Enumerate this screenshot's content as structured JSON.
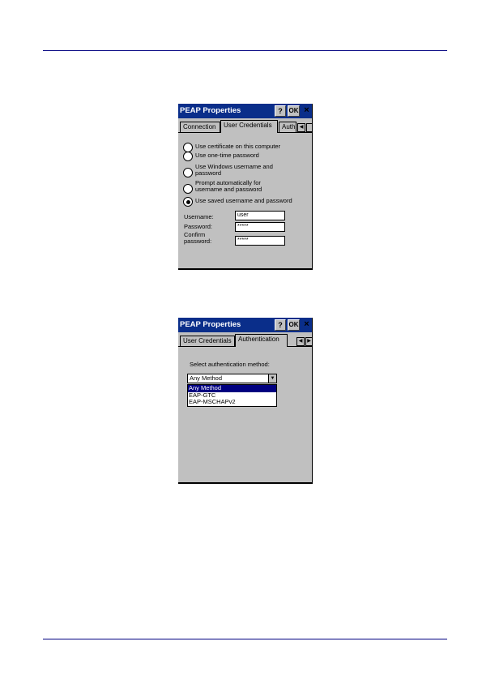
{
  "dialog1": {
    "title": "PEAP Properties",
    "help": "?",
    "ok": "OK",
    "close": "×",
    "tabs": [
      "Connection",
      "User Credentials",
      "Auth"
    ],
    "spin_left": "◀",
    "radios": [
      {
        "label": "Use certificate on this computer",
        "checked": false
      },
      {
        "label": "Use one-time password",
        "checked": false
      },
      {
        "label1": "Use Windows username and",
        "label2": "password",
        "checked": false
      },
      {
        "label1": "Prompt automatically for",
        "label2": "username and password",
        "checked": false
      },
      {
        "label": "Use saved username and password",
        "checked": true
      }
    ],
    "fields": {
      "username_label": "Username:",
      "username_value": "user",
      "password_label": "Password:",
      "password_value": "*****",
      "confirm_label1": "Confirm",
      "confirm_label2": "password:",
      "confirm_value": "*****"
    }
  },
  "dialog2": {
    "title": "PEAP Properties",
    "help": "?",
    "ok": "OK",
    "close": "×",
    "tabs": [
      "User Credentials",
      "Authentication"
    ],
    "spin_left": "◀",
    "spin_right": "▶",
    "select_label": "Select authentication method:",
    "selected": "Any Method",
    "arrow": "▼",
    "options": [
      "Any Method",
      "EAP-GTC",
      "EAP-MSCHAPv2"
    ]
  },
  "colors": {
    "titlebar": "#0a2e8a",
    "face": "#c0c0c0",
    "highlight": "#000080",
    "rule": "#000080"
  }
}
